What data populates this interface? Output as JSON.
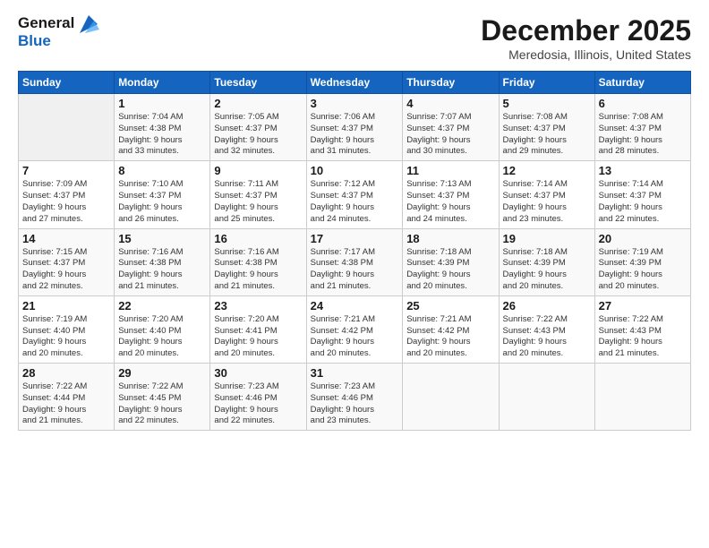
{
  "header": {
    "logo_line1": "General",
    "logo_line2": "Blue",
    "title": "December 2025",
    "subtitle": "Meredosia, Illinois, United States"
  },
  "calendar": {
    "days_of_week": [
      "Sunday",
      "Monday",
      "Tuesday",
      "Wednesday",
      "Thursday",
      "Friday",
      "Saturday"
    ],
    "weeks": [
      [
        {
          "num": "",
          "info": ""
        },
        {
          "num": "1",
          "info": "Sunrise: 7:04 AM\nSunset: 4:38 PM\nDaylight: 9 hours\nand 33 minutes."
        },
        {
          "num": "2",
          "info": "Sunrise: 7:05 AM\nSunset: 4:37 PM\nDaylight: 9 hours\nand 32 minutes."
        },
        {
          "num": "3",
          "info": "Sunrise: 7:06 AM\nSunset: 4:37 PM\nDaylight: 9 hours\nand 31 minutes."
        },
        {
          "num": "4",
          "info": "Sunrise: 7:07 AM\nSunset: 4:37 PM\nDaylight: 9 hours\nand 30 minutes."
        },
        {
          "num": "5",
          "info": "Sunrise: 7:08 AM\nSunset: 4:37 PM\nDaylight: 9 hours\nand 29 minutes."
        },
        {
          "num": "6",
          "info": "Sunrise: 7:08 AM\nSunset: 4:37 PM\nDaylight: 9 hours\nand 28 minutes."
        }
      ],
      [
        {
          "num": "7",
          "info": ""
        },
        {
          "num": "8",
          "info": "Sunrise: 7:10 AM\nSunset: 4:37 PM\nDaylight: 9 hours\nand 26 minutes."
        },
        {
          "num": "9",
          "info": "Sunrise: 7:11 AM\nSunset: 4:37 PM\nDaylight: 9 hours\nand 25 minutes."
        },
        {
          "num": "10",
          "info": "Sunrise: 7:12 AM\nSunset: 4:37 PM\nDaylight: 9 hours\nand 24 minutes."
        },
        {
          "num": "11",
          "info": "Sunrise: 7:13 AM\nSunset: 4:37 PM\nDaylight: 9 hours\nand 24 minutes."
        },
        {
          "num": "12",
          "info": "Sunrise: 7:14 AM\nSunset: 4:37 PM\nDaylight: 9 hours\nand 23 minutes."
        },
        {
          "num": "13",
          "info": "Sunrise: 7:14 AM\nSunset: 4:37 PM\nDaylight: 9 hours\nand 22 minutes."
        }
      ],
      [
        {
          "num": "14",
          "info": ""
        },
        {
          "num": "15",
          "info": "Sunrise: 7:16 AM\nSunset: 4:38 PM\nDaylight: 9 hours\nand 21 minutes."
        },
        {
          "num": "16",
          "info": "Sunrise: 7:16 AM\nSunset: 4:38 PM\nDaylight: 9 hours\nand 21 minutes."
        },
        {
          "num": "17",
          "info": "Sunrise: 7:17 AM\nSunset: 4:38 PM\nDaylight: 9 hours\nand 21 minutes."
        },
        {
          "num": "18",
          "info": "Sunrise: 7:18 AM\nSunset: 4:39 PM\nDaylight: 9 hours\nand 20 minutes."
        },
        {
          "num": "19",
          "info": "Sunrise: 7:18 AM\nSunset: 4:39 PM\nDaylight: 9 hours\nand 20 minutes."
        },
        {
          "num": "20",
          "info": "Sunrise: 7:19 AM\nSunset: 4:39 PM\nDaylight: 9 hours\nand 20 minutes."
        }
      ],
      [
        {
          "num": "21",
          "info": ""
        },
        {
          "num": "22",
          "info": "Sunrise: 7:20 AM\nSunset: 4:40 PM\nDaylight: 9 hours\nand 20 minutes."
        },
        {
          "num": "23",
          "info": "Sunrise: 7:20 AM\nSunset: 4:41 PM\nDaylight: 9 hours\nand 20 minutes."
        },
        {
          "num": "24",
          "info": "Sunrise: 7:21 AM\nSunset: 4:42 PM\nDaylight: 9 hours\nand 20 minutes."
        },
        {
          "num": "25",
          "info": "Sunrise: 7:21 AM\nSunset: 4:42 PM\nDaylight: 9 hours\nand 20 minutes."
        },
        {
          "num": "26",
          "info": "Sunrise: 7:22 AM\nSunset: 4:43 PM\nDaylight: 9 hours\nand 20 minutes."
        },
        {
          "num": "27",
          "info": "Sunrise: 7:22 AM\nSunset: 4:43 PM\nDaylight: 9 hours\nand 21 minutes."
        }
      ],
      [
        {
          "num": "28",
          "info": "Sunrise: 7:22 AM\nSunset: 4:44 PM\nDaylight: 9 hours\nand 21 minutes."
        },
        {
          "num": "29",
          "info": "Sunrise: 7:22 AM\nSunset: 4:45 PM\nDaylight: 9 hours\nand 22 minutes."
        },
        {
          "num": "30",
          "info": "Sunrise: 7:23 AM\nSunset: 4:46 PM\nDaylight: 9 hours\nand 22 minutes."
        },
        {
          "num": "31",
          "info": "Sunrise: 7:23 AM\nSunset: 4:46 PM\nDaylight: 9 hours\nand 23 minutes."
        },
        {
          "num": "",
          "info": ""
        },
        {
          "num": "",
          "info": ""
        },
        {
          "num": "",
          "info": ""
        }
      ]
    ],
    "week1_sun_info": "Sunrise: 7:09 AM\nSunset: 4:37 PM\nDaylight: 9 hours\nand 27 minutes.",
    "week3_sun_info": "Sunrise: 7:15 AM\nSunset: 4:37 PM\nDaylight: 9 hours\nand 22 minutes.",
    "week4_sun_info": "Sunrise: 7:19 AM\nSunset: 4:40 PM\nDaylight: 9 hours\nand 20 minutes."
  }
}
